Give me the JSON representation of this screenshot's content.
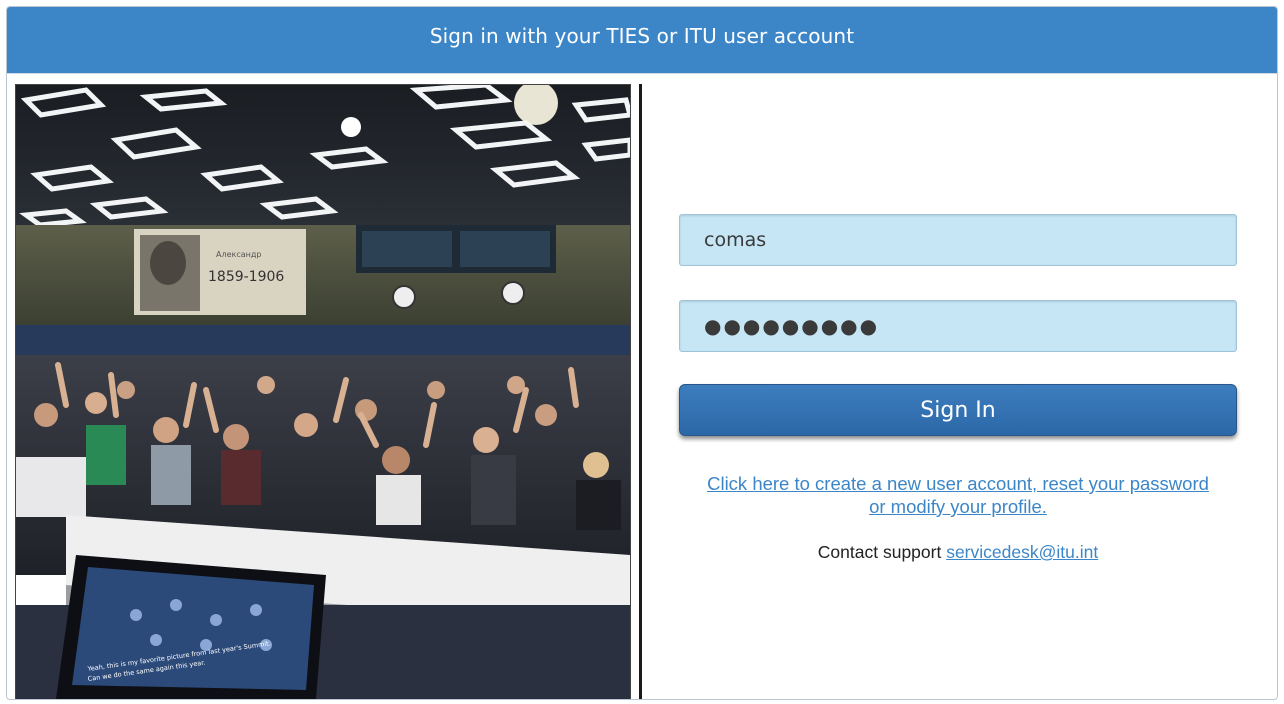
{
  "header": {
    "title": "Sign in with your TIES or ITU user account"
  },
  "photo": {
    "portrait_caption": "1859-1906",
    "screen_caption_line1": "Yeah, this is my favorite picture from last year's Summit.",
    "screen_caption_line2": "Can we do the same again this year."
  },
  "form": {
    "username_value": "comas",
    "password_value": "●●●●●●●●●",
    "signin_label": "Sign In",
    "create_account_link": "Click here to create a new user account, reset your password or modify your profile.",
    "support_prefix": "Contact support ",
    "support_email": "servicedesk@itu.int"
  },
  "colors": {
    "accent": "#3c86c8",
    "input_bg": "#c6e6f6",
    "button": "#2e6aaa"
  }
}
